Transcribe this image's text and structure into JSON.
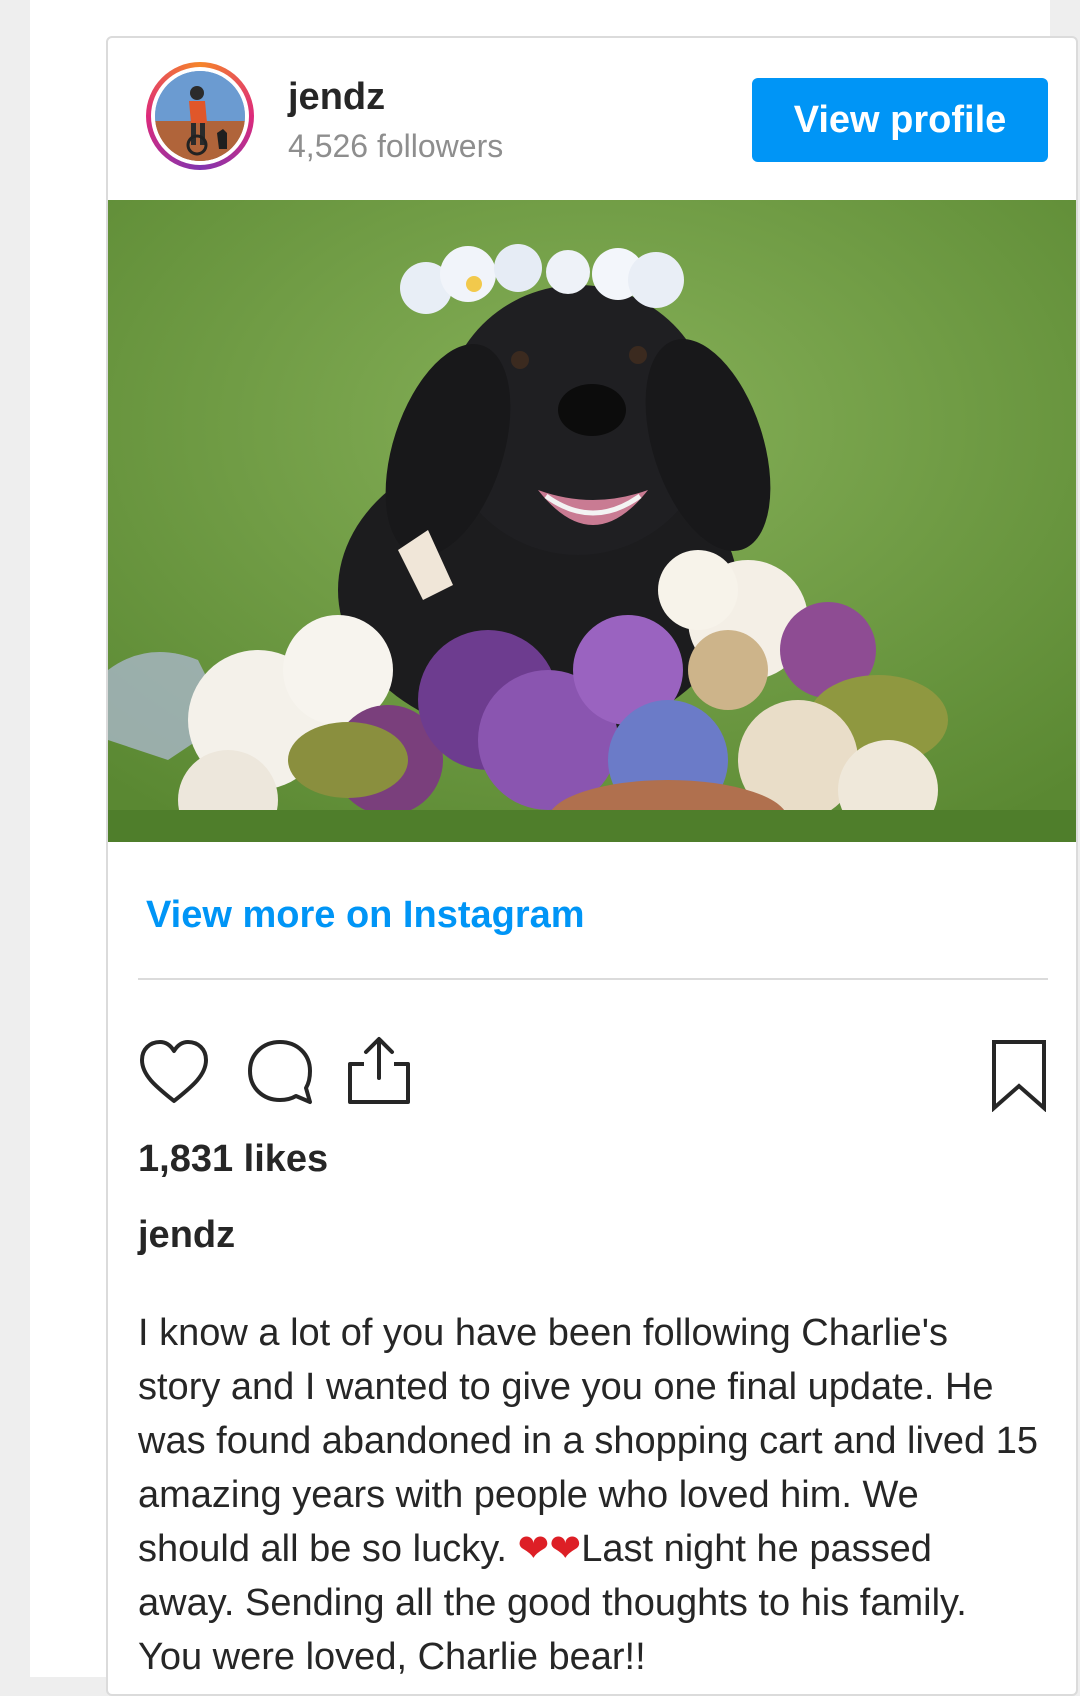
{
  "post": {
    "username": "jendz",
    "followers": "4,526 followers",
    "view_profile_label": "View profile",
    "view_more_label": "View more on Instagram",
    "likes": "1,831 likes",
    "caption_user": "jendz",
    "caption_part1": "I know a lot of you have been following Charlie's story and I wanted to give you one final update. He was found abandoned in a shopping cart and lived 15 amazing years with people who loved him. We should all be so lucky. ",
    "caption_hearts": "❤❤",
    "caption_part2": "Last night he passed away. Sending all the good thoughts to his family. You were loved, Charlie bear!!"
  },
  "icons": {
    "like": "heart-icon",
    "comment": "comment-icon",
    "share": "share-icon",
    "save": "bookmark-icon"
  },
  "colors": {
    "accent": "#0095f6",
    "text": "#262626",
    "muted": "#8e8e8e",
    "heart": "#dd1f26"
  }
}
